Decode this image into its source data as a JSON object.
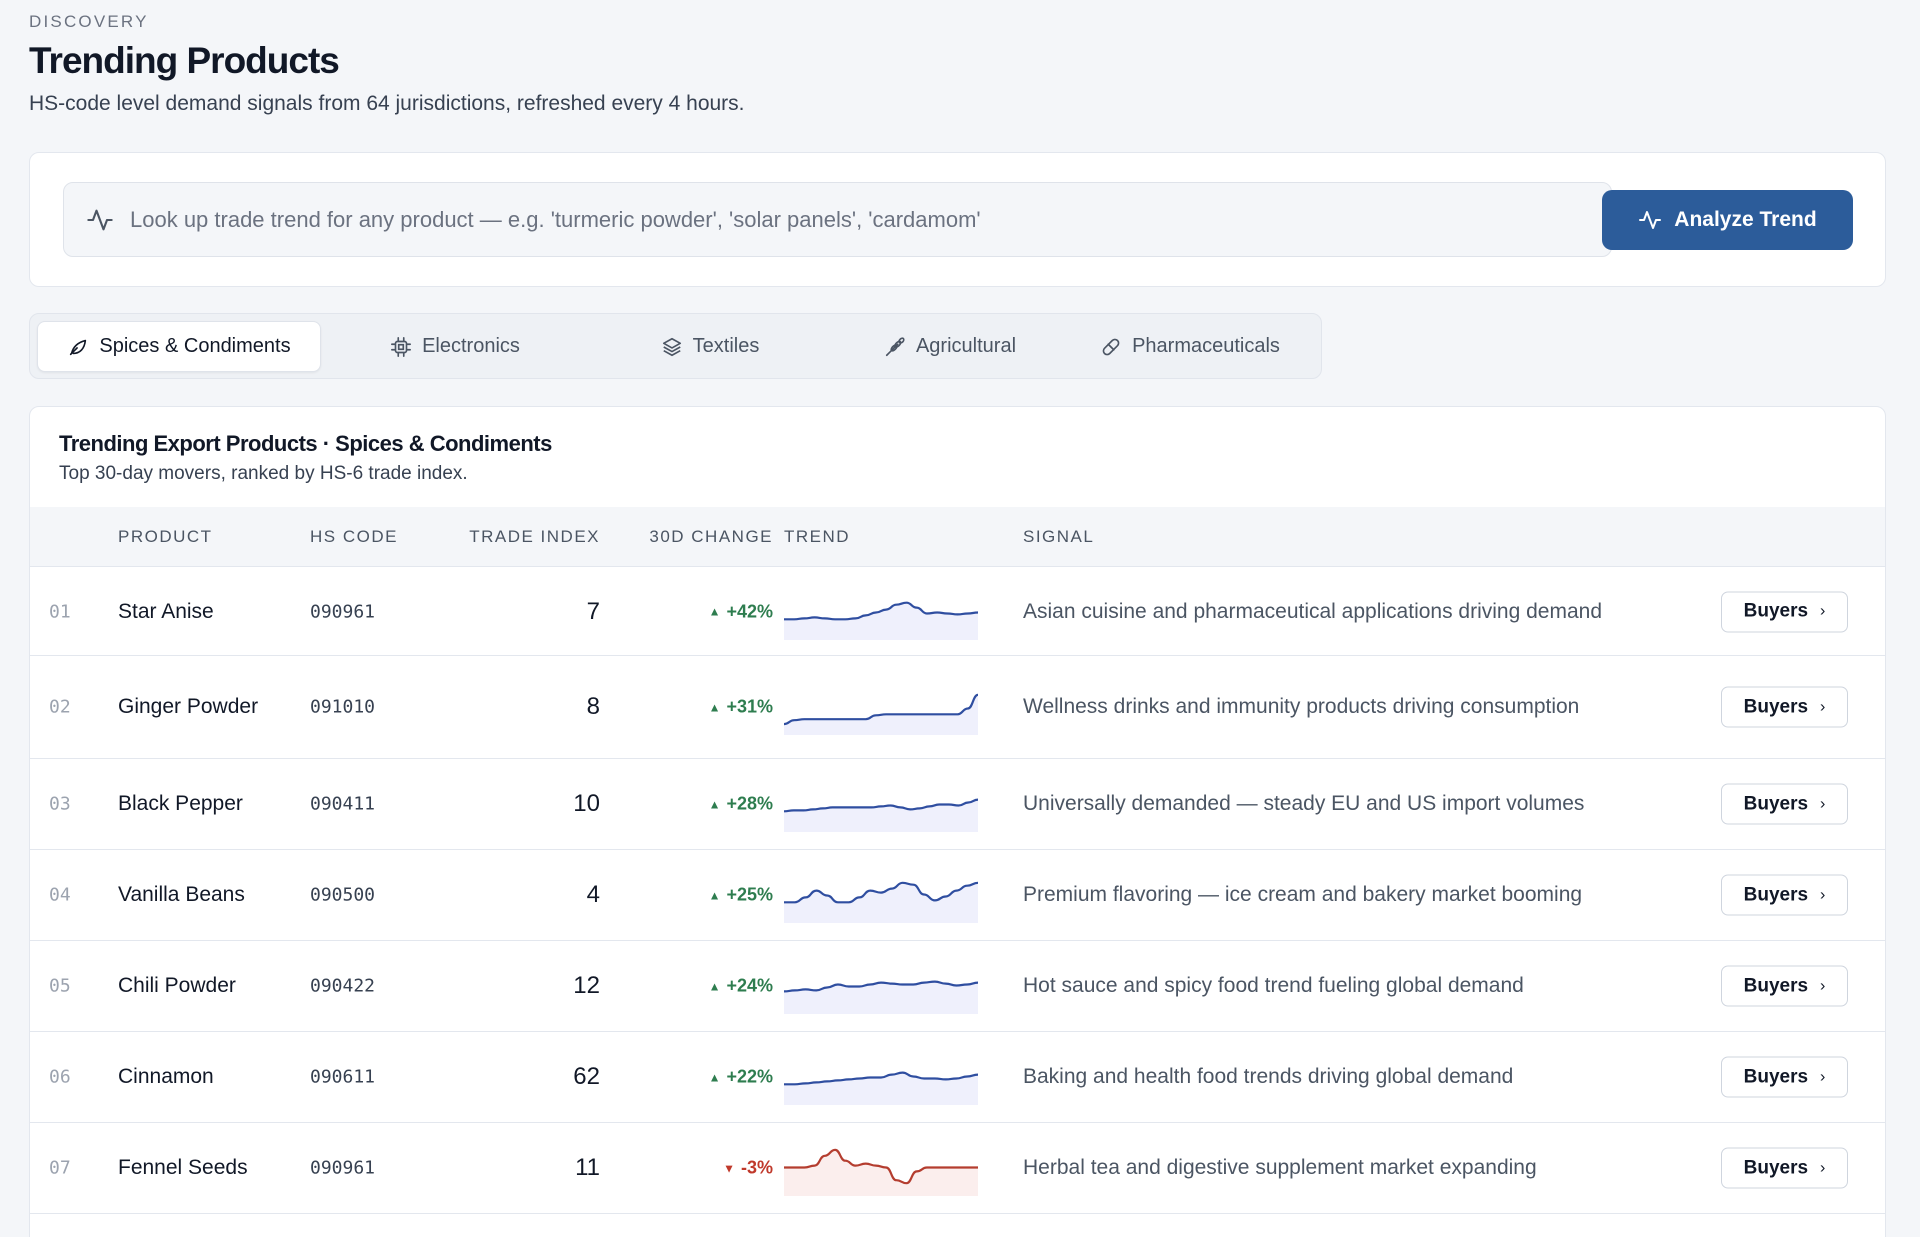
{
  "header": {
    "eyebrow": "DISCOVERY",
    "title": "Trending Products",
    "subtitle": "HS-code level demand signals from 64 jurisdictions, refreshed every 4 hours."
  },
  "search": {
    "placeholder": "Look up trade trend for any product — e.g. 'turmeric powder', 'solar panels', 'cardamom'",
    "value": "",
    "button_label": "Analyze Trend"
  },
  "tabs": [
    {
      "label": "Spices & Condiments",
      "icon": "leaf-icon",
      "active": true
    },
    {
      "label": "Electronics",
      "icon": "chip-icon",
      "active": false
    },
    {
      "label": "Textiles",
      "icon": "layers-icon",
      "active": false
    },
    {
      "label": "Agricultural",
      "icon": "wheat-icon",
      "active": false
    },
    {
      "label": "Pharmaceuticals",
      "icon": "pill-icon",
      "active": false
    }
  ],
  "table": {
    "title": "Trending Export Products · Spices & Condiments",
    "subtitle": "Top 30-day movers, ranked by HS-6 trade index.",
    "columns": {
      "product": "PRODUCT",
      "hs_code": "HS CODE",
      "trade_index": "TRADE INDEX",
      "change": "30D CHANGE",
      "trend": "TREND",
      "signal": "SIGNAL"
    },
    "buyers_label": "Buyers",
    "rows": [
      {
        "rank": "01",
        "product": "Star Anise",
        "hs_code": "090961",
        "trade_index": "7",
        "change": "+42%",
        "direction": "up",
        "signal": "Asian cuisine and pharmaceutical applications driving demand",
        "trend": [
          40,
          40,
          41,
          42,
          41,
          40,
          40,
          41,
          44,
          47,
          50,
          55,
          57,
          52,
          46,
          47,
          46,
          45,
          46,
          47
        ]
      },
      {
        "rank": "02",
        "product": "Ginger Powder",
        "hs_code": "091010",
        "trade_index": "8",
        "change": "+31%",
        "direction": "up",
        "signal": "Wellness drinks and immunity products driving consumption",
        "trend": [
          30,
          34,
          35,
          35,
          35,
          35,
          35,
          35,
          35,
          39,
          40,
          40,
          40,
          40,
          40,
          40,
          40,
          40,
          46,
          60
        ]
      },
      {
        "rank": "03",
        "product": "Black Pepper",
        "hs_code": "090411",
        "trade_index": "10",
        "change": "+28%",
        "direction": "up",
        "signal": "Universally demanded — steady EU and US import volumes",
        "trend": [
          40,
          41,
          41,
          42,
          43,
          44,
          44,
          44,
          44,
          44,
          45,
          46,
          44,
          42,
          43,
          45,
          47,
          47,
          46,
          49,
          52
        ]
      },
      {
        "rank": "04",
        "product": "Vanilla Beans",
        "hs_code": "090500",
        "trade_index": "4",
        "change": "+25%",
        "direction": "up",
        "signal": "Premium flavoring — ice cream and bakery market booming",
        "trend": [
          40,
          40,
          45,
          52,
          47,
          40,
          40,
          45,
          52,
          50,
          54,
          60,
          58,
          48,
          42,
          46,
          52,
          57,
          60
        ]
      },
      {
        "rank": "05",
        "product": "Chili Powder",
        "hs_code": "090422",
        "trade_index": "12",
        "change": "+24%",
        "direction": "up",
        "signal": "Hot sauce and spicy food trend fueling global demand",
        "trend": [
          42,
          43,
          44,
          43,
          46,
          49,
          47,
          47,
          49,
          51,
          50,
          49,
          49,
          51,
          52,
          50,
          48,
          49,
          51
        ]
      },
      {
        "rank": "06",
        "product": "Cinnamon",
        "hs_code": "090611",
        "trade_index": "62",
        "change": "+22%",
        "direction": "up",
        "signal": "Baking and health food trends driving global demand",
        "trend": [
          40,
          40,
          41,
          42,
          43,
          44,
          45,
          46,
          47,
          47,
          50,
          52,
          48,
          46,
          46,
          45,
          46,
          48,
          50
        ]
      },
      {
        "rank": "07",
        "product": "Fennel Seeds",
        "hs_code": "090961",
        "trade_index": "11",
        "change": "-3%",
        "direction": "down",
        "signal": "Herbal tea and digestive supplement market expanding",
        "trend": [
          48,
          48,
          48,
          50,
          60,
          66,
          55,
          50,
          52,
          50,
          48,
          35,
          32,
          44,
          48,
          48,
          48,
          48,
          48,
          48
        ]
      }
    ]
  },
  "colors": {
    "accent": "#2c5c9a",
    "up": "#2e7d4f",
    "down": "#c0392b",
    "spark_up": "#2f4ea0",
    "spark_down": "#b43d2f"
  }
}
